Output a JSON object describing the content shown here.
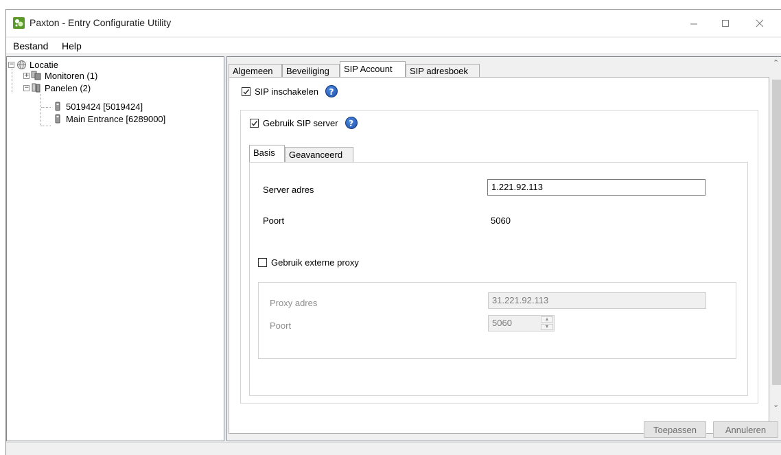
{
  "window": {
    "title": "Paxton - Entry Configuratie Utility",
    "controls": {
      "minimize": "—",
      "maximize": "☐",
      "close": "✕"
    }
  },
  "menu": [
    {
      "label": "Bestand"
    },
    {
      "label": "Help"
    }
  ],
  "tree": {
    "root": {
      "label": "Locatie",
      "expander": "−",
      "icon": "globe-icon"
    },
    "monitors": {
      "label": "Monitoren (1)",
      "expander": "+",
      "icon": "monitor-group-icon"
    },
    "panels": {
      "label": "Panelen (2)",
      "expander": "−",
      "icon": "panel-group-icon"
    },
    "panel_items": [
      {
        "label": "5019424 [5019424]",
        "icon": "panel-icon"
      },
      {
        "label": "Main Entrance [6289000]",
        "icon": "panel-icon"
      }
    ]
  },
  "tabs": [
    {
      "label": "Algemeen",
      "active": false
    },
    {
      "label": "Beveiliging",
      "active": false
    },
    {
      "label": "SIP Account",
      "active": true
    },
    {
      "label": "SIP adresboek",
      "active": false
    }
  ],
  "sip": {
    "enable_label": "SIP inschakelen",
    "enable_checked": true,
    "use_server_label": "Gebruik SIP server",
    "use_server_checked": true,
    "subtabs": [
      {
        "label": "Basis",
        "active": true
      },
      {
        "label": "Geavanceerd",
        "active": false
      }
    ],
    "server_address_label": "Server adres",
    "server_address_value": "1.221.92.113",
    "port_label": "Poort",
    "port_value": "5060",
    "external_proxy_label": "Gebruik externe proxy",
    "external_proxy_checked": false,
    "proxy_address_label": "Proxy adres",
    "proxy_address_value": "31.221.92.113",
    "proxy_port_label": "Poort",
    "proxy_port_value": "5060"
  },
  "buttons": {
    "apply": "Toepassen",
    "cancel": "Annuleren"
  },
  "colors": {
    "app_icon": "#5a9a2a",
    "help_icon": "#1d4fa8",
    "window_bg": "#f0f0f0"
  }
}
